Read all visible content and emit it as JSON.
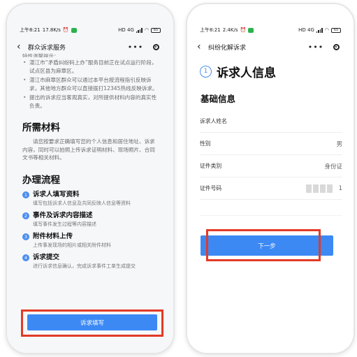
{
  "left": {
    "status": {
      "time": "上午8:21",
      "speed": "17.8K/s",
      "right": "HD 4G",
      "battery": "65"
    },
    "nav_title": "群众诉求服务",
    "more_label": "•••",
    "truncated_text": "特性温馨提示：",
    "bullets": [
      "湛江市“矛盾纠纷码上办”服务目前正在试点运行阶段，试点区县为麻章区。",
      "湛江市麻章区群众可以通过本平台按流程指引反映诉求，其他地方群众可以直接拨打12345热线反映诉求。",
      "提出的诉求应当客观真实，对所提供材料内容的真实性负责。"
    ],
    "materials_title": "所需材料",
    "materials_text": "请您按要求正确填写您的个人信息和居住地址、诉求内容，同时可以拍照上传诉求证明材料、现场照片、合同文书等相关材料。",
    "process_title": "办理流程",
    "steps": [
      {
        "num": "1",
        "title": "诉求人填写资料",
        "desc": "填写包括诉求人信息及共同反映人信息等资料"
      },
      {
        "num": "2",
        "title": "事件及诉求内容描述",
        "desc": "填写事件发生过程等内容描述"
      },
      {
        "num": "3",
        "title": "附件材料上传",
        "desc": "上传事发现场的相片或相关附件材料"
      },
      {
        "num": "4",
        "title": "诉求提交",
        "desc": "进行诉求信息确认，完成诉求事件工单生成提交"
      }
    ],
    "button_label": "诉求填写"
  },
  "right": {
    "status": {
      "time": "上午8:21",
      "speed": "2.4K/s",
      "right": "HD 4G",
      "battery": "65"
    },
    "nav_title": "纠纷化解诉求",
    "more_label": "•••",
    "step_num": "1",
    "title": "诉求人信息",
    "section": "基础信息",
    "fields": [
      {
        "label": "诉求人姓名",
        "value": ""
      },
      {
        "label": "性别",
        "value": "男"
      },
      {
        "label": "证件类别",
        "value": "身份证"
      },
      {
        "label": "证件号码",
        "value": "1"
      }
    ],
    "button_label": "下一步"
  },
  "colors": {
    "accent": "#3c89f4",
    "highlight": "#e33a26",
    "wechat_green": "#2bb24c"
  }
}
